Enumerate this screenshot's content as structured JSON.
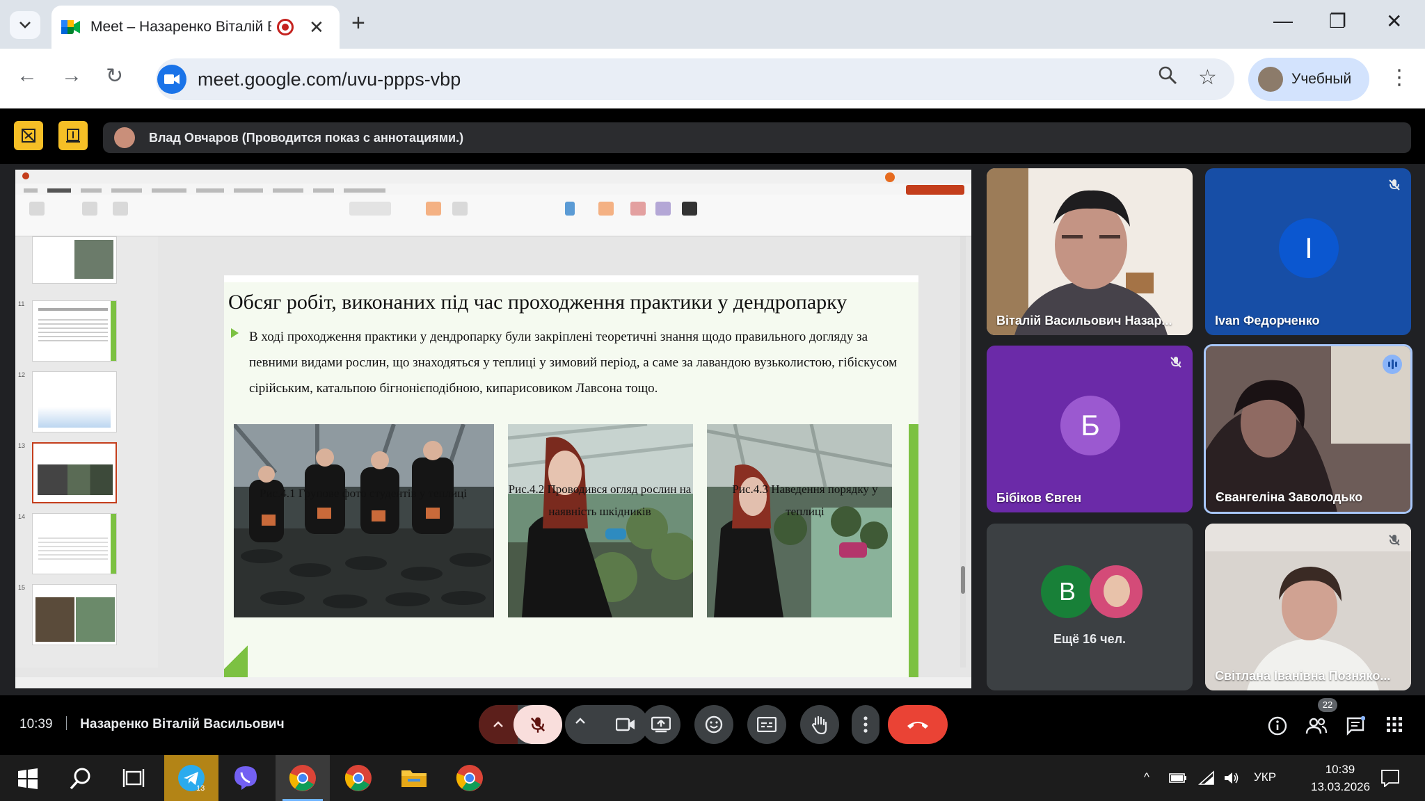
{
  "browser": {
    "tab_title": "Meet – Назаренко Віталій Ва",
    "url": "meet.google.com/uvu-ppps-vbp",
    "profile_label": "Учебный"
  },
  "meet": {
    "presenter_text": "Влад Овчаров (Проводится показ с аннотациями.)",
    "clock": "10:39",
    "user_name": "Назаренко Віталій Васильович",
    "participant_count": "22"
  },
  "slide": {
    "title": "Обсяг робіт, виконаних під час проходження практики у дендропарку",
    "body": "В ході проходження практики у дендропарку були закріплені теоретичні знання щодо правильного догляду за певними видами рослин, що знаходяться у теплиці у зимовий період, а саме за лавандою вузьколистою, гібіскусом сірійським, катальпою бігнонієподібною, кипарисовиком Лавсона тощо.",
    "captions": [
      "Рис.4.1 Групове фото студентів у теплиці",
      "Рис.4.2 Проводився огляд рослин на наявність шкідників",
      "Рис.4.3 Наведення порядку у теплиці"
    ],
    "thumb_numbers": [
      "11",
      "12",
      "13",
      "14",
      "15"
    ]
  },
  "participants": [
    {
      "name": "Віталій Васильович Назар...",
      "type": "video"
    },
    {
      "name": "Ivan Федорченко",
      "initial": "I",
      "color": "#0b57d0",
      "type": "avatar"
    },
    {
      "name": "Бібіков Євген",
      "initial": "Б",
      "color": "#8e44c0",
      "type": "avatar"
    },
    {
      "name": "Євангеліна Заволодько",
      "type": "video"
    },
    {
      "name": "Ещё 16 чел.",
      "initial": "B",
      "color": "#188038",
      "type": "group"
    },
    {
      "name": "Світлана Іванівна Позняко...",
      "type": "video"
    }
  ],
  "taskbar": {
    "lang": "УКР",
    "time": "10:39",
    "date": "13.03.2026",
    "telegram_badge": "13"
  },
  "colors": {
    "meet_bg": "#000000",
    "end_call": "#ea4335",
    "muted": "#f9dedc",
    "accent_green": "#7cc142"
  }
}
